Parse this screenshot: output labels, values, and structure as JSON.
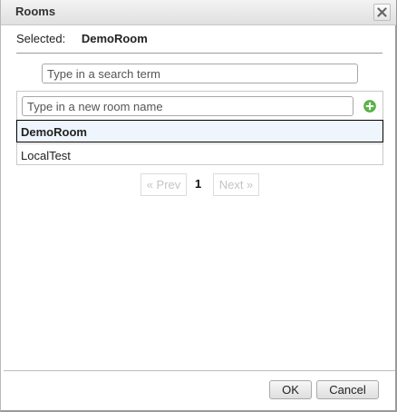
{
  "dialog": {
    "title": "Rooms",
    "close_icon": "close-icon"
  },
  "selection": {
    "label": "Selected:",
    "value": "DemoRoom"
  },
  "search": {
    "placeholder": "Type in a search term",
    "value": ""
  },
  "new_room": {
    "placeholder": "Type in a new room name",
    "value": "",
    "add_icon": "add-circle-icon",
    "add_icon_color": "#5cb84a"
  },
  "rooms": [
    {
      "name": "DemoRoom",
      "selected": true
    },
    {
      "name": "LocalTest",
      "selected": false
    }
  ],
  "pagination": {
    "prev_label": "« Prev",
    "current_page": "1",
    "next_label": "Next »"
  },
  "footer": {
    "ok_label": "OK",
    "cancel_label": "Cancel"
  }
}
